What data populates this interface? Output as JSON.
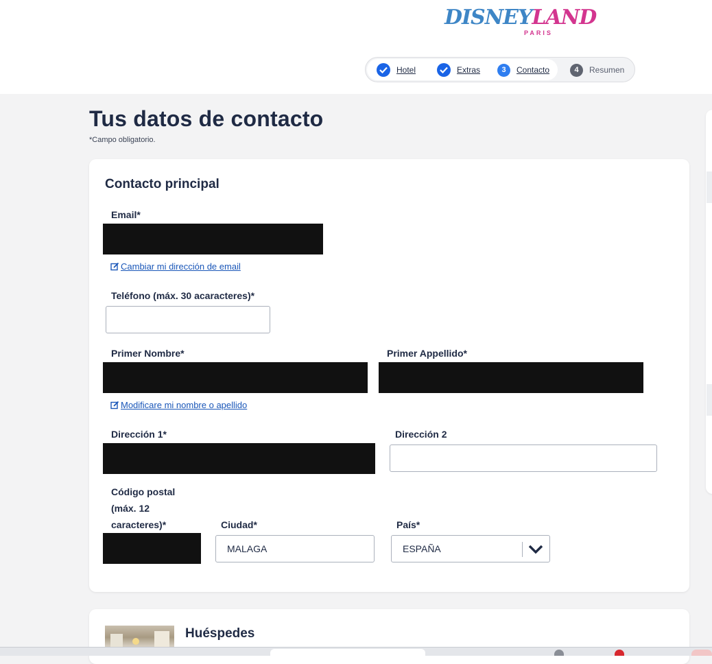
{
  "header": {
    "logo_main_a": "D",
    "logo_main_b": "ISNEY",
    "logo_main_c": "LAND",
    "logo_sub": "PARIS",
    "steps": [
      {
        "number": "✓",
        "label": "Hotel",
        "state": "done"
      },
      {
        "number": "✓",
        "label": "Extras",
        "state": "done"
      },
      {
        "number": "3",
        "label": "Contacto",
        "state": "current"
      },
      {
        "number": "4",
        "label": "Resumen",
        "state": "todo"
      }
    ]
  },
  "page": {
    "title": "Tus datos de contacto",
    "required_note": "*Campo obligatorio."
  },
  "contact": {
    "section_title": "Contacto principal",
    "email_label": "Email*",
    "change_email_link": "Cambiar mi dirección de email",
    "phone_label": "Teléfono (máx. 30 acaracteres)*",
    "phone_value": "",
    "first_name_label": "Primer Nombre*",
    "last_name_label": "Primer Appellido*",
    "modify_name_link": "Modificare mi nombre o apellido",
    "address1_label": "Dirección 1*",
    "address2_label": "Dirección 2",
    "address2_value": "",
    "postal_label_line1": "Código postal",
    "postal_label_line2": "(máx. 12",
    "postal_label_line3": "caracteres)*",
    "city_label": "Ciudad*",
    "city_value": "MALAGA",
    "country_label": "País*",
    "country_value": "ESPAÑA"
  },
  "guests": {
    "title": "Huéspedes"
  },
  "colors": {
    "accent": "#1a64e6",
    "text": "#1f2a44",
    "link": "#1956b8",
    "background": "#f3f3f4"
  }
}
